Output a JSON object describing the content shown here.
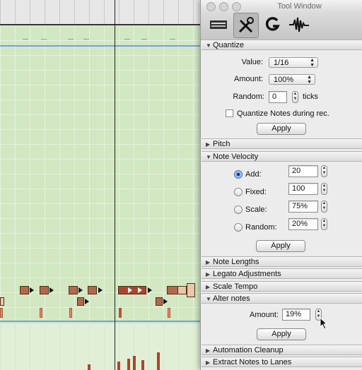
{
  "window": {
    "title": "Tool Window",
    "toolbar": [
      {
        "name": "Toolbar",
        "icon": "toolbar-icon"
      },
      {
        "name": "Tools",
        "icon": "tools-icon",
        "active": true
      },
      {
        "name": "Groove",
        "icon": "groove-icon"
      },
      {
        "name": "Audio",
        "icon": "waveform-icon"
      }
    ]
  },
  "quantize": {
    "header": "Quantize",
    "value_label": "Value:",
    "value": "1/16",
    "amount_label": "Amount:",
    "amount": "100%",
    "random_label": "Random:",
    "random": "0",
    "random_unit": "ticks",
    "during_rec_label": "Quantize Notes during rec.",
    "during_rec_checked": false,
    "apply_label": "Apply"
  },
  "pitch": {
    "header": "Pitch"
  },
  "note_velocity": {
    "header": "Note Velocity",
    "options": [
      {
        "label": "Add:",
        "value": "20",
        "selected": true
      },
      {
        "label": "Fixed:",
        "value": "100",
        "selected": false
      },
      {
        "label": "Scale:",
        "value": "75%",
        "selected": false
      },
      {
        "label": "Random:",
        "value": "20%",
        "selected": false
      }
    ],
    "apply_label": "Apply"
  },
  "note_lengths": {
    "header": "Note Lengths"
  },
  "legato": {
    "header": "Legato Adjustments"
  },
  "scale_tempo": {
    "header": "Scale Tempo"
  },
  "alter_notes": {
    "header": "Alter notes",
    "amount_label": "Amount:",
    "amount": "19%",
    "apply_label": "Apply"
  },
  "automation_cleanup": {
    "header": "Automation Cleanup"
  },
  "extract_notes": {
    "header": "Extract Notes to Lanes"
  },
  "colors": {
    "grid_bg": "#d1e8c3",
    "note": "#b06a4a",
    "playhead": "#222222",
    "selection": "#3a6fc4"
  }
}
